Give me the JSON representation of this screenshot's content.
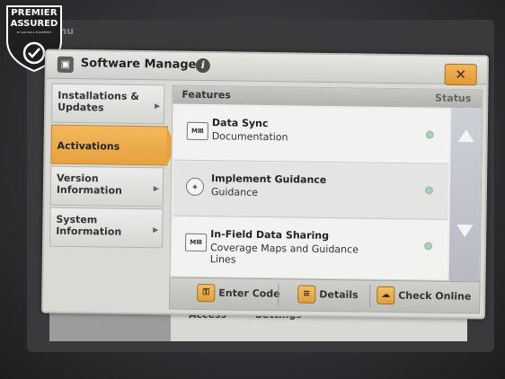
{
  "badge": {
    "line1": "PREMIER",
    "line2": "ASSURED",
    "sub": "BY VAN WALL EQUIPMENT"
  },
  "window": {
    "title": "Software Manager",
    "app_icon": "software-manager-icon",
    "info_icon": "info-icon",
    "close_icon": "close-icon",
    "close_label": "✕"
  },
  "sidebar": {
    "items": [
      {
        "label": "Installations & Updates",
        "active": false
      },
      {
        "label": "Activations",
        "active": true
      },
      {
        "label": "Version Information",
        "active": false
      },
      {
        "label": "System Information",
        "active": false
      }
    ]
  },
  "panel": {
    "header_features": "Features",
    "header_status": "Status",
    "rows": [
      {
        "name": "Data Sync",
        "desc": "Documentation",
        "icon": "data-sync-icon"
      },
      {
        "name": "Implement Guidance",
        "desc": "Guidance",
        "icon": "implement-guidance-icon"
      },
      {
        "name": "In-Field Data Sharing",
        "desc": "Coverage Maps and Guidance Lines",
        "icon": "data-sharing-icon"
      }
    ]
  },
  "bottombar": {
    "enter_code": "Enter Code",
    "details": "Details",
    "check_online": "Check Online"
  },
  "background": {
    "text_menu": "Menu",
    "text_access": "Access",
    "text_settings": "Settings"
  }
}
